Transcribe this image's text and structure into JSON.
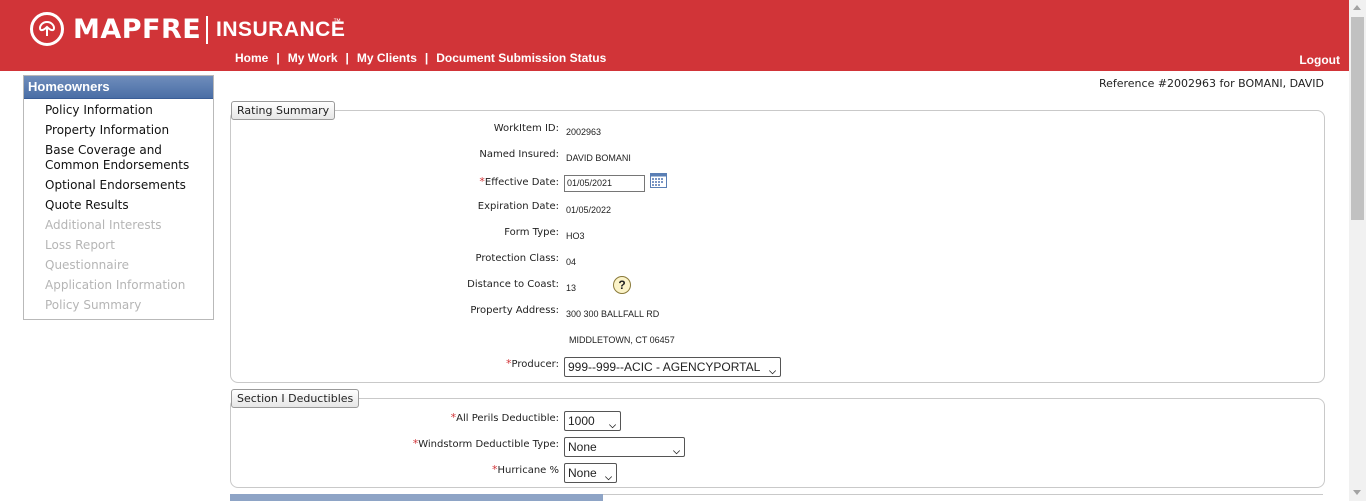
{
  "brand": {
    "name": "MAPFRE",
    "product": "INSURANCE",
    "tm": "™",
    "color": "#d13438"
  },
  "nav": {
    "items": [
      "Home",
      "My Work",
      "My Clients",
      "Document Submission Status"
    ],
    "separator": "|",
    "logout": "Logout"
  },
  "sidebar": {
    "title": "Homeowners",
    "items": [
      {
        "label": "Policy Information",
        "enabled": true
      },
      {
        "label": "Property Information",
        "enabled": true
      },
      {
        "label": "Base Coverage and\nCommon Endorsements",
        "enabled": true
      },
      {
        "label": "Optional Endorsements",
        "enabled": true
      },
      {
        "label": "Quote Results",
        "enabled": true
      },
      {
        "label": "Additional Interests",
        "enabled": false
      },
      {
        "label": "Loss Report",
        "enabled": false
      },
      {
        "label": "Questionnaire",
        "enabled": false
      },
      {
        "label": "Application Information",
        "enabled": false
      },
      {
        "label": "Policy Summary",
        "enabled": false
      }
    ]
  },
  "reference": "Reference #2002963 for BOMANI, DAVID",
  "rating_summary": {
    "tab": "Rating Summary",
    "workitem_label": "WorkItem ID:",
    "workitem_value": "2002963",
    "named_insured_label": "Named Insured:",
    "named_insured_value": "DAVID BOMANI",
    "effective_label": "Effective Date:",
    "effective_value": "01/05/2021",
    "expiration_label": "Expiration Date:",
    "expiration_value": "01/05/2022",
    "form_type_label": "Form Type:",
    "form_type_value": "HO3",
    "protection_label": "Protection Class:",
    "protection_value": "04",
    "distance_label": "Distance to Coast:",
    "distance_value": "13",
    "address_label": "Property Address:",
    "address_line1": "300 300 BALLFALL RD",
    "address_line2": "MIDDLETOWN, CT 06457",
    "producer_label": "Producer:",
    "producer_value": "999--999--ACIC - AGENCYPORTAL"
  },
  "deductibles": {
    "tab": "Section I Deductibles",
    "all_perils_label": "All Perils Deductible:",
    "all_perils_value": "1000",
    "windstorm_label": "Windstorm Deductible Type:",
    "windstorm_value": "None",
    "hurricane_label": "Hurricane %",
    "hurricane_value": "None"
  },
  "required_mark": "*",
  "help_mark": "?",
  "chevron": "⌄"
}
